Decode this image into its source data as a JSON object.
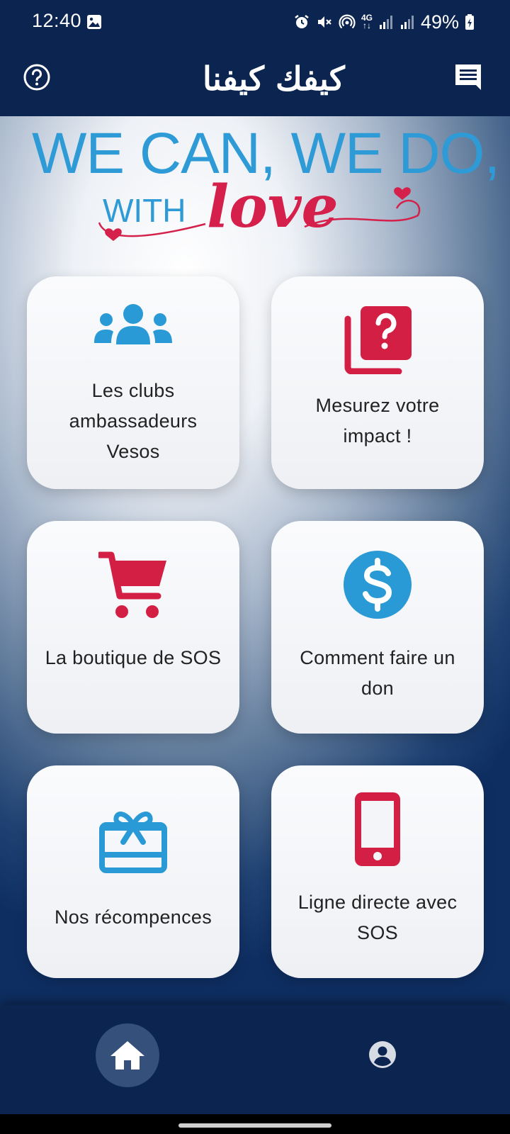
{
  "status_bar": {
    "time": "12:40",
    "network_type_top": "4G",
    "network_type_bottom": "↑↓",
    "battery": "49%"
  },
  "header": {
    "logo_text": "كيفك كيفنا"
  },
  "banner": {
    "line1": "WE CAN, WE DO,",
    "with": "WITH",
    "love": "love"
  },
  "tiles": [
    {
      "label": "Les clubs ambassadeurs Vesos",
      "icon": "group-icon",
      "color": "#2a9ad6"
    },
    {
      "label": "Mesurez votre impact !",
      "icon": "quiz-icon",
      "color": "#d41f45"
    },
    {
      "label": "La boutique de SOS",
      "icon": "cart-icon",
      "color": "#d41f45"
    },
    {
      "label": "Comment faire un don",
      "icon": "dollar-icon",
      "color": "#2a9ad6"
    },
    {
      "label": "Nos récompences",
      "icon": "gift-card-icon",
      "color": "#2a9ad6"
    },
    {
      "label": "Ligne directe avec SOS",
      "icon": "phone-icon",
      "color": "#d41f45"
    }
  ],
  "colors": {
    "header_bg": "#0b2450",
    "accent_blue": "#2a9ad6",
    "accent_red": "#d41f45"
  }
}
